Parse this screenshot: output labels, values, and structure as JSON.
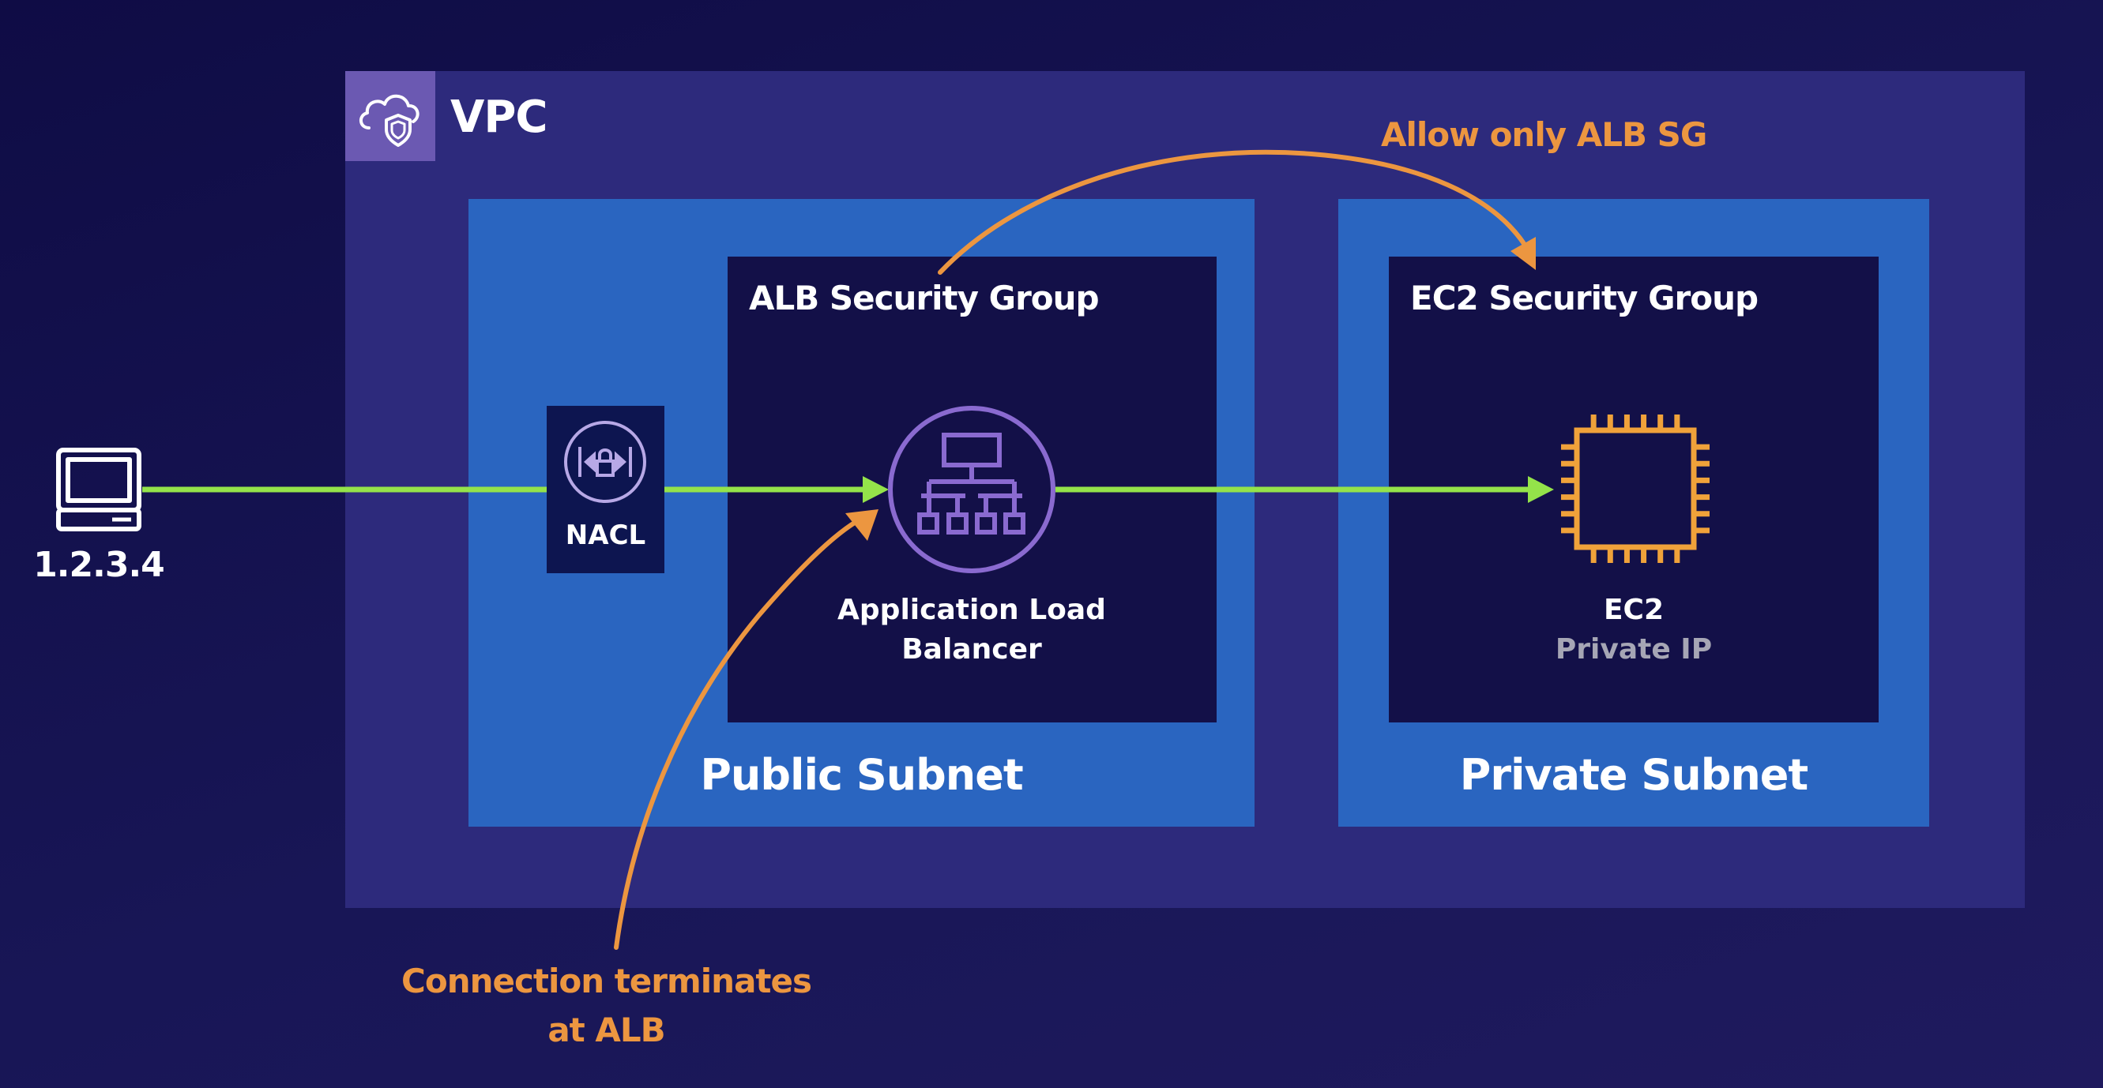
{
  "vpc": {
    "label": "VPC",
    "icon": "cloud-shield-icon"
  },
  "public_subnet": {
    "label": "Public Subnet"
  },
  "private_subnet": {
    "label": "Private Subnet"
  },
  "alb_security_group": {
    "label": "ALB Security Group"
  },
  "ec2_security_group": {
    "label": "EC2 Security Group"
  },
  "nacl": {
    "label": "NACL",
    "icon": "nacl-lock-icon"
  },
  "alb": {
    "line1": "Application Load",
    "line2": "Balancer",
    "icon": "load-balancer-icon"
  },
  "ec2": {
    "title": "EC2",
    "subtitle": "Private IP",
    "icon": "chip-icon"
  },
  "client": {
    "label": "1.2.3.4",
    "icon": "laptop-icon"
  },
  "annotations": {
    "top": "Allow only ALB SG",
    "bottom_line1": "Connection terminates",
    "bottom_line2": "at ALB"
  },
  "colors": {
    "background": "#141250",
    "vpc": "#2d2a7c",
    "subnet": "#2a65c0",
    "security_group": "#131048",
    "flow": "#94e34a",
    "annotation": "#ec9640",
    "alb_icon": "#8a6ad0",
    "ec2_icon": "#f0a23a"
  }
}
